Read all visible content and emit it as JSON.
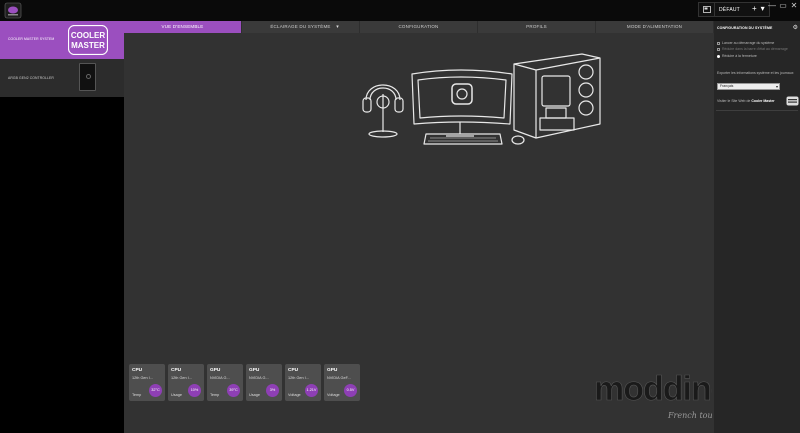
{
  "window": {
    "controls": [
      "—",
      "▭",
      "✕"
    ],
    "profile": {
      "label": "DÉFAUT",
      "add_label": "+",
      "menu_label": "▾"
    }
  },
  "devices": [
    {
      "name": "COOLER MASTER SYSTEM",
      "active": true,
      "logo_text_1": "COOLER",
      "logo_text_2": "MASTER"
    },
    {
      "name": "ARGB GEN2 CONTROLLER",
      "active": false
    }
  ],
  "tabs": [
    {
      "label": "VUE D'ENSEMBLE",
      "active": true
    },
    {
      "label": "ÉCLAIRAGE DU SYSTÈME",
      "active": false,
      "has_caret": true,
      "caret": "▾"
    },
    {
      "label": "CONFIGURATION",
      "active": false
    },
    {
      "label": "PROFILS",
      "active": false
    },
    {
      "label": "MODE D'ALIMENTATION",
      "active": false
    }
  ],
  "cards": [
    {
      "title": "CPU",
      "sub": "12th Gen I...",
      "metric": "Temp",
      "value": "32°C"
    },
    {
      "title": "CPU",
      "sub": "12th Gen I...",
      "metric": "Usage",
      "value": "10%"
    },
    {
      "title": "GPU",
      "sub": "NVIDIA G...",
      "metric": "Temp",
      "value": "39°C"
    },
    {
      "title": "GPU",
      "sub": "NVIDIA G...",
      "metric": "Usage",
      "value": "3%"
    },
    {
      "title": "CPU",
      "sub": "12th Gen I...",
      "metric": "Voltage",
      "value": "1.21V"
    },
    {
      "title": "GPU",
      "sub": "NVIDIA GeF...",
      "metric": "Voltage",
      "value": "0.5V"
    }
  ],
  "settings": {
    "title": "CONFIGURATION DU SYSTÈME",
    "options": [
      {
        "label": "Lancer au démarrage du système",
        "type": "checkbox",
        "dim": false
      },
      {
        "label": "Réduire dans la barre d'état au démarrage",
        "type": "checkbox",
        "dim": true
      },
      {
        "label": "Réduire à la fermeture",
        "type": "radio",
        "dim": false
      }
    ],
    "export_text": "Exporter les informations système et les journaux",
    "language": "Français",
    "language_chevron": "▾",
    "visit_prefix": "Visiter le Site Web de ",
    "visit_brand": "Cooler Master"
  },
  "watermark": {
    "main": "modding.fr",
    "sub": "French touch"
  },
  "colors": {
    "accent": "#9b4fbf",
    "badge": "#8e3fb5",
    "panel": "#323232"
  },
  "icons": {
    "gear": "⚙"
  }
}
